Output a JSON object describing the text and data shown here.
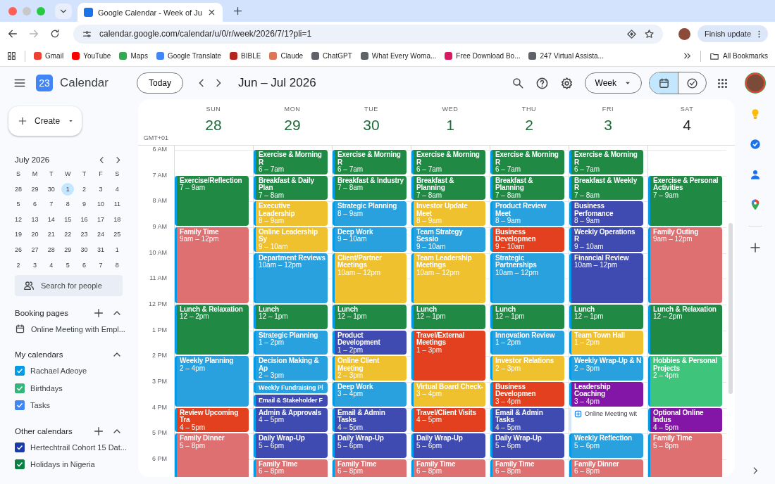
{
  "browser": {
    "tab_title": "Google Calendar - Week of Ju",
    "url": "calendar.google.com/calendar/u/0/r/week/2026/7/1?pli=1",
    "update_button": "Finish update",
    "bookmarks": [
      "Gmail",
      "YouTube",
      "Maps",
      "Google Translate",
      "BIBLE",
      "Claude",
      "ChatGPT",
      "What Every Woma...",
      "Free Download Bo...",
      "247 Virtual Assista..."
    ],
    "all_bookmarks": "All Bookmarks"
  },
  "header": {
    "logo_text": "23",
    "title": "Calendar",
    "today_button": "Today",
    "date_range": "Jun – Jul 2026",
    "view_select": "Week",
    "view_toggle": [
      {
        "selected": true
      },
      {
        "selected": false
      }
    ]
  },
  "sidebar": {
    "create_button": "Create",
    "mini_calendar": {
      "title": "July 2026",
      "weekdays": [
        "S",
        "M",
        "T",
        "W",
        "T",
        "F",
        "S"
      ],
      "weeks": [
        [
          {
            "d": "28",
            "selected": false
          },
          {
            "d": "29",
            "selected": false
          },
          {
            "d": "30",
            "selected": false
          },
          {
            "d": "1",
            "selected": true
          },
          {
            "d": "2",
            "selected": false
          },
          {
            "d": "3",
            "selected": false
          },
          {
            "d": "4",
            "selected": false
          }
        ],
        [
          {
            "d": "5",
            "selected": false
          },
          {
            "d": "6",
            "selected": false
          },
          {
            "d": "7",
            "selected": false
          },
          {
            "d": "8",
            "selected": false
          },
          {
            "d": "9",
            "selected": false
          },
          {
            "d": "10",
            "selected": false
          },
          {
            "d": "11",
            "selected": false
          }
        ],
        [
          {
            "d": "12",
            "selected": false
          },
          {
            "d": "13",
            "selected": false
          },
          {
            "d": "14",
            "selected": false
          },
          {
            "d": "15",
            "selected": false
          },
          {
            "d": "16",
            "selected": false
          },
          {
            "d": "17",
            "selected": false
          },
          {
            "d": "18",
            "selected": false
          }
        ],
        [
          {
            "d": "19",
            "selected": false
          },
          {
            "d": "20",
            "selected": false
          },
          {
            "d": "21",
            "selected": false
          },
          {
            "d": "22",
            "selected": false
          },
          {
            "d": "23",
            "selected": false
          },
          {
            "d": "24",
            "selected": false
          },
          {
            "d": "25",
            "selected": false
          }
        ],
        [
          {
            "d": "26",
            "selected": false
          },
          {
            "d": "27",
            "selected": false
          },
          {
            "d": "28",
            "selected": false
          },
          {
            "d": "29",
            "selected": false
          },
          {
            "d": "30",
            "selected": false
          },
          {
            "d": "31",
            "selected": false
          },
          {
            "d": "1",
            "selected": false
          }
        ],
        [
          {
            "d": "2",
            "selected": false
          },
          {
            "d": "3",
            "selected": false
          },
          {
            "d": "4",
            "selected": false
          },
          {
            "d": "5",
            "selected": false
          },
          {
            "d": "6",
            "selected": false
          },
          {
            "d": "7",
            "selected": false
          },
          {
            "d": "8",
            "selected": false
          }
        ]
      ]
    },
    "search": {
      "placeholder": "Search for people"
    },
    "booking_pages": {
      "title": "Booking pages",
      "items": [
        "Online Meeting with Empl..."
      ]
    },
    "my_calendars": {
      "title": "My calendars",
      "items": [
        {
          "label": "Rachael Adeoye",
          "checked": true,
          "color": "#039be5"
        },
        {
          "label": "Birthdays",
          "checked": true,
          "color": "#33b679"
        },
        {
          "label": "Tasks",
          "checked": true,
          "color": "#4285f4"
        }
      ]
    },
    "other_calendars": {
      "title": "Other calendars",
      "items": [
        {
          "label": "Hertechtrail Cohort 15 Dat...",
          "checked": true,
          "color": "#1a3aa8"
        },
        {
          "label": "Holidays in Nigeria",
          "checked": true,
          "color": "#0b8043"
        }
      ]
    }
  },
  "calendar": {
    "timezone": "GMT+01",
    "hours": [
      "6 AM",
      "7 AM",
      "8 AM",
      "9 AM",
      "10 AM",
      "11 AM",
      "12 PM",
      "1 PM",
      "2 PM",
      "3 PM",
      "4 PM",
      "5 PM",
      "6 PM"
    ],
    "days": [
      {
        "name": "SUN",
        "number": "28",
        "highlighted": true,
        "late_start": true,
        "events": [
          {
            "kind": "two-hour",
            "title": "Exercise/Reflection",
            "time": "7 – 9am",
            "color": "#208a45"
          },
          {
            "kind": "three-hour",
            "title": "Family Time",
            "time": "9am – 12pm",
            "color": "#df7072"
          },
          {
            "kind": "two-hour",
            "title": "Lunch & Relaxation",
            "time": "12 – 2pm",
            "color": "#208a45"
          },
          {
            "kind": "two-hour",
            "title": "Weekly Planning",
            "time": "2 – 4pm",
            "color": "#2aa1df"
          },
          {
            "kind": "hour",
            "title": "Review Upcoming Tra",
            "time": "4 – 5pm",
            "color": "#e3401f"
          },
          {
            "kind": "three-hour",
            "title": "Family Dinner",
            "time": "5 – 8pm",
            "color": "#df7072"
          }
        ]
      },
      {
        "name": "MON",
        "number": "29",
        "highlighted": true,
        "late_start": false,
        "events": [
          {
            "kind": "hour",
            "title": "Exercise & Morning R",
            "time": "6 – 7am",
            "color": "#208a45"
          },
          {
            "kind": "hour",
            "title": "Breakfast & Daily Plan",
            "time": "7 – 8am",
            "color": "#208a45"
          },
          {
            "kind": "hour",
            "title": "Executive Leadership",
            "time": "8 – 9am",
            "color": "#f0c12e"
          },
          {
            "kind": "hour",
            "title": "Online Leadership Sy",
            "time": "9 – 10am",
            "color": "#f0c12e"
          },
          {
            "kind": "two-hour",
            "title": "Department Reviews",
            "time": "10am – 12pm",
            "color": "#2aa1df"
          },
          {
            "kind": "hour",
            "title": "Lunch",
            "time": "12 – 1pm",
            "color": "#208a45"
          },
          {
            "kind": "hour",
            "title": "Strategic Planning",
            "time": "1 – 2pm",
            "color": "#2aa1df"
          },
          {
            "kind": "hour",
            "title": "Decision Making & Ap",
            "time": "2 – 3pm",
            "color": "#2aa1df"
          },
          {
            "kind": "half-hour",
            "title": "Weekly Fundraising Pl",
            "color": "#2aa1df"
          },
          {
            "kind": "half-hour",
            "title": "Email & Stakeholder F",
            "color": "#3f4bb1"
          },
          {
            "kind": "hour",
            "title": "Admin & Approvals",
            "time": "4 – 5pm",
            "color": "#3f4bb1"
          },
          {
            "kind": "hour",
            "title": "Daily Wrap-Up",
            "time": "5 – 6pm",
            "color": "#3f4bb1"
          },
          {
            "kind": "two-hour",
            "title": "Family Time",
            "time": "6 – 8pm",
            "color": "#df7072"
          }
        ]
      },
      {
        "name": "TUE",
        "number": "30",
        "highlighted": true,
        "late_start": false,
        "events": [
          {
            "kind": "hour",
            "title": "Exercise & Morning R",
            "time": "6 – 7am",
            "color": "#208a45"
          },
          {
            "kind": "hour",
            "title": "Breakfast & Industry",
            "time": "7 – 8am",
            "color": "#208a45"
          },
          {
            "kind": "hour",
            "title": "Strategic Planning",
            "time": "8 – 9am",
            "color": "#2aa1df"
          },
          {
            "kind": "hour",
            "title": "Deep Work",
            "time": "9 – 10am",
            "color": "#2aa1df"
          },
          {
            "kind": "two-hour",
            "title": "Client/Partner Meetings",
            "time": "10am – 12pm",
            "color": "#f0c12e"
          },
          {
            "kind": "hour",
            "title": "Lunch",
            "time": "12 – 1pm",
            "color": "#208a45"
          },
          {
            "kind": "hour",
            "title": "Product Development",
            "time": "1 – 2pm",
            "color": "#3f4bb1"
          },
          {
            "kind": "hour",
            "title": "Online Client Meeting",
            "time": "2 – 3pm",
            "color": "#f0c12e"
          },
          {
            "kind": "hour",
            "title": "Deep Work",
            "time": "3 – 4pm",
            "color": "#2aa1df"
          },
          {
            "kind": "hour",
            "title": "Email & Admin Tasks",
            "time": "4 – 5pm",
            "color": "#3f4bb1"
          },
          {
            "kind": "hour",
            "title": "Daily Wrap-Up",
            "time": "5 – 6pm",
            "color": "#3f4bb1"
          },
          {
            "kind": "two-hour",
            "title": "Family Time",
            "time": "6 – 8pm",
            "color": "#df7072"
          }
        ]
      },
      {
        "name": "WED",
        "number": "1",
        "highlighted": true,
        "late_start": false,
        "events": [
          {
            "kind": "hour",
            "title": "Exercise & Morning R",
            "time": "6 – 7am",
            "color": "#208a45"
          },
          {
            "kind": "hour",
            "title": "Breakfast & Planning",
            "time": "7 – 8am",
            "color": "#208a45"
          },
          {
            "kind": "hour",
            "title": "Investor Update Meet",
            "time": "8 – 9am",
            "color": "#f0c12e"
          },
          {
            "kind": "hour",
            "title": "Team Strategy Sessio",
            "time": "9 – 10am",
            "color": "#2aa1df"
          },
          {
            "kind": "two-hour",
            "title": "Team Leadership Meetings",
            "time": "10am – 12pm",
            "color": "#f0c12e"
          },
          {
            "kind": "hour",
            "title": "Lunch",
            "time": "12 – 1pm",
            "color": "#208a45"
          },
          {
            "kind": "two-hour",
            "title": "Travel/External Meetings",
            "time": "1 – 3pm",
            "color": "#e3401f"
          },
          {
            "kind": "hour",
            "title": "Virtual Board Check-",
            "time": "3 – 4pm",
            "color": "#f0c12e"
          },
          {
            "kind": "hour",
            "title": "Travel/Client Visits",
            "time": "4 – 5pm",
            "color": "#e3401f"
          },
          {
            "kind": "hour",
            "title": "Daily Wrap-Up",
            "time": "5 – 6pm",
            "color": "#3f4bb1"
          },
          {
            "kind": "two-hour",
            "title": "Family Time",
            "time": "6 – 8pm",
            "color": "#df7072"
          }
        ]
      },
      {
        "name": "THU",
        "number": "2",
        "highlighted": true,
        "late_start": false,
        "events": [
          {
            "kind": "hour",
            "title": "Exercise & Morning R",
            "time": "6 – 7am",
            "color": "#208a45"
          },
          {
            "kind": "hour",
            "title": "Breakfast & Planning",
            "time": "7 – 8am",
            "color": "#208a45"
          },
          {
            "kind": "hour",
            "title": "Product Review Meet",
            "time": "8 – 9am",
            "color": "#2aa1df"
          },
          {
            "kind": "hour",
            "title": "Business Developmen",
            "time": "9 – 10am",
            "color": "#e3401f"
          },
          {
            "kind": "two-hour",
            "title": "Strategic Partnerships",
            "time": "10am – 12pm",
            "color": "#2aa1df"
          },
          {
            "kind": "hour",
            "title": "Lunch",
            "time": "12 – 1pm",
            "color": "#208a45"
          },
          {
            "kind": "hour",
            "title": "Innovation Review",
            "time": "1 – 2pm",
            "color": "#2aa1df"
          },
          {
            "kind": "hour",
            "title": "Investor Relations",
            "time": "2 – 3pm",
            "color": "#f0c12e"
          },
          {
            "kind": "hour",
            "title": "Business Developmen",
            "time": "3 – 4pm",
            "color": "#e3401f"
          },
          {
            "kind": "hour",
            "title": "Email & Admin Tasks",
            "time": "4 – 5pm",
            "color": "#3f4bb1"
          },
          {
            "kind": "hour",
            "title": "Daily Wrap-Up",
            "time": "5 – 6pm",
            "color": "#3f4bb1"
          },
          {
            "kind": "two-hour",
            "title": "Family Time",
            "time": "6 – 8pm",
            "color": "#df7072"
          }
        ]
      },
      {
        "name": "FRI",
        "number": "3",
        "highlighted": true,
        "late_start": false,
        "events": [
          {
            "kind": "hour",
            "title": "Exercise & Morning R",
            "time": "6 – 7am",
            "color": "#208a45"
          },
          {
            "kind": "hour",
            "title": "Breakfast & Weekly R",
            "time": "7 – 8am",
            "color": "#208a45"
          },
          {
            "kind": "hour",
            "title": "Business Perfomance",
            "time": "8 – 9am",
            "color": "#3f4bb1"
          },
          {
            "kind": "hour",
            "title": "Weekly Operations R",
            "time": "9 – 10am",
            "color": "#3f4bb1"
          },
          {
            "kind": "two-hour",
            "title": "Financial Review",
            "time": "10am – 12pm",
            "color": "#3f4bb1"
          },
          {
            "kind": "hour",
            "title": "Lunch",
            "time": "12 – 1pm",
            "color": "#208a45"
          },
          {
            "kind": "hour",
            "title": "Team Town Hall",
            "time": "1 – 2pm",
            "color": "#f0c12e"
          },
          {
            "kind": "hour",
            "title": "Weekly Wrap-Up & N",
            "time": "2 – 3pm",
            "color": "#2aa1df"
          },
          {
            "kind": "hour",
            "title": "Leadership Coaching",
            "time": "3 – 4pm",
            "color": "#8316a7"
          },
          {
            "kind": "booking",
            "title": "Online Meeting wit"
          },
          {
            "kind": "hour",
            "title": "Weekly Reflection",
            "time": "5 – 6pm",
            "color": "#2aa1df"
          },
          {
            "kind": "two-hour",
            "title": "Family Dinner",
            "time": "6 – 8pm",
            "color": "#df7072"
          }
        ]
      },
      {
        "name": "SAT",
        "number": "4",
        "highlighted": false,
        "late_start": true,
        "events": [
          {
            "kind": "two-hour",
            "title": "Exercise & Personal Activities",
            "time": "7 – 9am",
            "color": "#208a45"
          },
          {
            "kind": "three-hour",
            "title": "Family Outing",
            "time": "9am – 12pm",
            "color": "#df7072"
          },
          {
            "kind": "two-hour",
            "title": "Lunch & Relaxation",
            "time": "12 – 2pm",
            "color": "#208a45"
          },
          {
            "kind": "two-hour",
            "title": "Hobbies & Personal Projects",
            "time": "2 – 4pm",
            "color": "#3fc47c"
          },
          {
            "kind": "hour",
            "title": "Optional Online Indus",
            "time": "4 – 5pm",
            "color": "#8316a7"
          },
          {
            "kind": "three-hour",
            "title": "Family Time",
            "time": "5 – 8pm",
            "color": "#df7072"
          }
        ]
      }
    ]
  }
}
